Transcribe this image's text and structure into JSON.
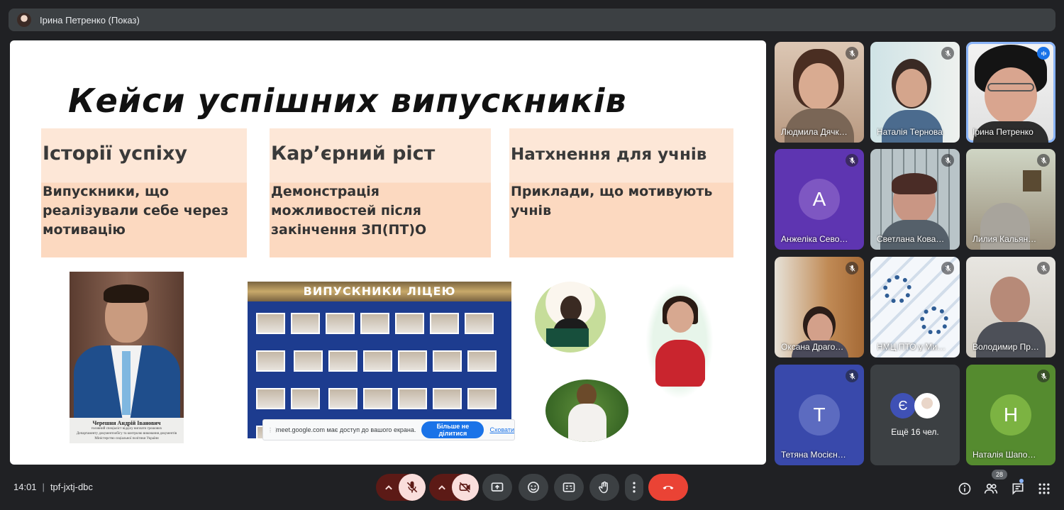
{
  "presenter_bar": {
    "label": "Ірина Петренко (Показ)"
  },
  "slide": {
    "title": "Кейси успішних випускників",
    "cards": [
      {
        "heading": "Історії успіху",
        "body": "Випускники, що реалізували себе через мотивацію"
      },
      {
        "heading": "Кар’єрний ріст",
        "body": "Демонстрація можливостей після закінчення ЗП(ПТ)О"
      },
      {
        "heading": "Натхнення для учнів",
        "body": "Приклади, що мотивують учнів"
      }
    ],
    "portrait_caption": {
      "name": "Черешня Андрій Іванович",
      "line1": "головний спеціаліст відділу виплати грошових",
      "line2": "Департаменту документообігу та контролю виконання документів",
      "line3": "Міністерство соціальної політики України"
    },
    "board_title": "ВИПУСКНИКИ ЛІЦЕЮ"
  },
  "share_notice": {
    "message": "meet.google.com має доступ до вашого екрана.",
    "stop_label": "Більше не ділитися",
    "hide_label": "Сховати"
  },
  "participants": [
    {
      "name": "Людмила Дячк…",
      "muted": true
    },
    {
      "name": "Наталія Тернова",
      "muted": true
    },
    {
      "name": "Ірина Петренко",
      "speaking": true
    },
    {
      "name": "Анжеліка Сево…",
      "letter": "А",
      "muted": true
    },
    {
      "name": "Светлана Кова…",
      "muted": true
    },
    {
      "name": "Лилия Кальян…",
      "muted": true
    },
    {
      "name": "Оксана Драго…",
      "muted": true
    },
    {
      "name": "НМЦ ПТО у Ми…",
      "muted": true
    },
    {
      "name": "Володимир Пр…",
      "muted": true
    },
    {
      "name": "Тетяна Мосієн…",
      "letter": "Т",
      "muted": true
    },
    {
      "name": "Наталія Шапо…",
      "letter": "Н",
      "muted": true
    }
  ],
  "more_tile": {
    "avatar_letter": "Є",
    "label": "Ещё 16 чел."
  },
  "bottom": {
    "time": "14:01",
    "meeting_code": "tpf-jxtj-dbc",
    "people_count": "28"
  },
  "colors": {
    "accent": "#1a73e8",
    "end_call": "#ea4335",
    "tile_purple": "#5e35b1",
    "tile_indigo": "#3949ab",
    "tile_green": "#558b2f"
  }
}
